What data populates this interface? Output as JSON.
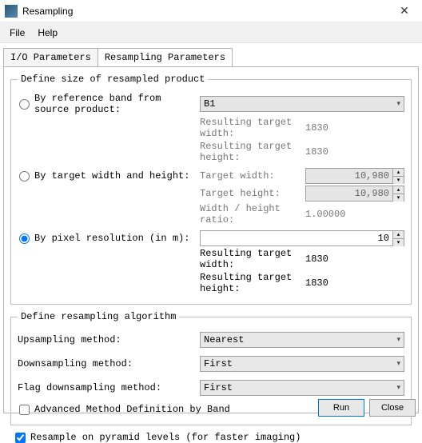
{
  "title": "Resampling",
  "menu": {
    "file": "File",
    "help": "Help"
  },
  "tabs": {
    "io": "I/O Parameters",
    "resamp": "Resampling Parameters"
  },
  "size_group": {
    "legend": "Define size of resampled product",
    "opt1": "By reference band from source product:",
    "opt2": "By target width and height:",
    "opt3": "By pixel resolution (in m):",
    "band": "B1",
    "res_w_lbl": "Resulting target width:",
    "res_h_lbl": "Resulting target height:",
    "res_w": "1830",
    "res_h": "1830",
    "tw_lbl": "Target width:",
    "th_lbl": "Target height:",
    "tw": "10,980",
    "th": "10,980",
    "ratio_lbl": "Width / height ratio:",
    "ratio": "1.00000",
    "pixres": "10",
    "res_w2": "1830",
    "res_h2": "1830"
  },
  "algo_group": {
    "legend": "Define resampling algorithm",
    "up_lbl": "Upsampling method:",
    "up": "Nearest",
    "down_lbl": "Downsampling method:",
    "down": "First",
    "flag_lbl": "Flag downsampling method:",
    "flag": "First",
    "adv": "Advanced Method Definition by Band"
  },
  "pyramid": "Resample on pyramid levels (for faster imaging)",
  "buttons": {
    "run": "Run",
    "close": "Close"
  }
}
